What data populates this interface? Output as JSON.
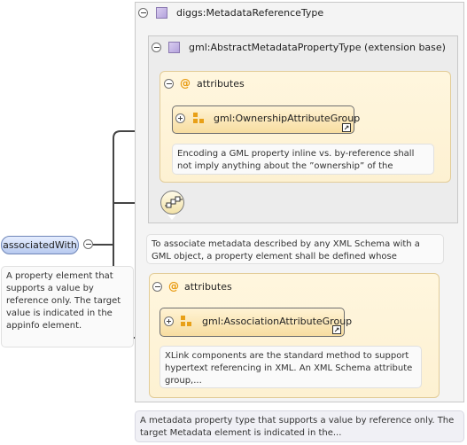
{
  "element": {
    "name": "associatedWith",
    "doc": "A property element that supports a value by reference only. The target value is indicated in the appinfo element."
  },
  "complex_type": {
    "name": "diggs:MetadataReferenceType",
    "doc": "A metadata property type that supports a value by reference only. The target Metadata element is indicated in the..."
  },
  "extension": {
    "name": "gml:AbstractMetadataPropertyType (extension base)",
    "attributes_label": "attributes",
    "attribute_group": {
      "name": "gml:OwnershipAttributeGroup",
      "doc": "Encoding a GML property inline vs. by-reference shall not imply anything about the ”ownership” of the contained or..."
    },
    "doc": "To associate metadata described by any XML Schema with a GML object, a property element shall be defined whose content..."
  },
  "own_attributes": {
    "label": "attributes",
    "attribute_group": {
      "name": "gml:AssociationAttributeGroup",
      "doc": "XLink components are the standard method to support hypertext referencing in XML. An XML Schema attribute group,..."
    }
  },
  "colors": {
    "attribute_accent": "#e89a10",
    "element_fill": "#c8d6f4",
    "type_icon": "#c4b4e4",
    "connector": "#444444"
  },
  "icons": [
    "collapse-icon",
    "expand-icon",
    "complex-type-icon",
    "attribute-icon",
    "attribute-group-icon",
    "link-arrow-icon",
    "sequence-icon"
  ]
}
